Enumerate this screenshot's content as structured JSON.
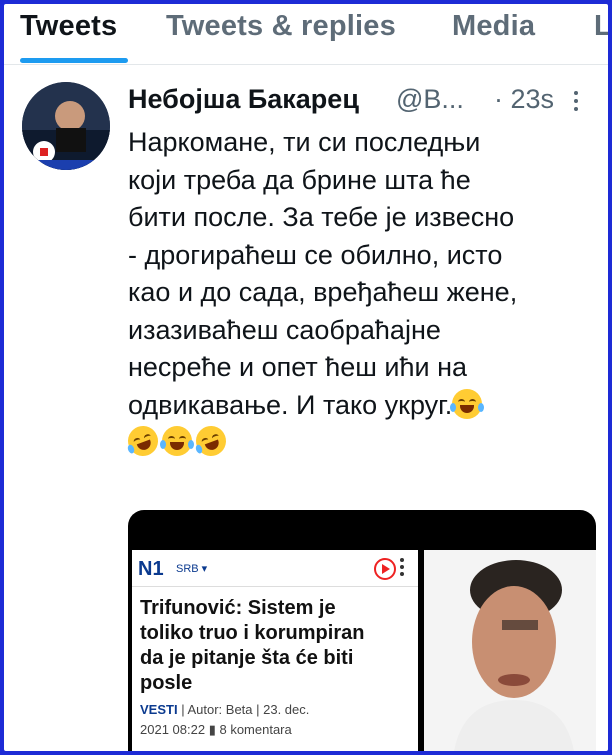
{
  "tabs": [
    {
      "label": "Tweets",
      "active": true
    },
    {
      "label": "Tweets & replies",
      "active": false
    },
    {
      "label": "Media",
      "active": false
    },
    {
      "label": "L",
      "active": false
    }
  ],
  "tweet": {
    "author_name": "Небојша Бакарец",
    "handle": "@B...",
    "time": "· 23s",
    "text_lines": [
      "Наркомане, ти си последњи",
      "који треба да брине шта ће",
      "бити после. За тебе је извесно",
      "- дрогираћеш се обилно, исто",
      "као и до сада, вређаћеш жене,",
      "изазиваћеш саобраћајне",
      "несреће и опет ћеш ићи на",
      "одвикавање. И тако укруг."
    ],
    "emojis": [
      "face-with-tears-of-joy",
      "rolling-on-floor-laughing",
      "face-with-tears-of-joy",
      "rolling-on-floor-laughing"
    ]
  },
  "media": {
    "logo": "N1",
    "region": "SRB",
    "headline_lines": [
      "Trifunović: Sistem je",
      "toliko truo i korumpiran",
      "da je pitanje šta će biti",
      "posle"
    ],
    "section": "VESTI",
    "author": "| Autor: Beta | 23. dec.",
    "datetime": "2021 08:22",
    "comments": "8 komentara"
  },
  "colors": {
    "accent": "#1d9bf0",
    "border": "#1d2bd6"
  }
}
